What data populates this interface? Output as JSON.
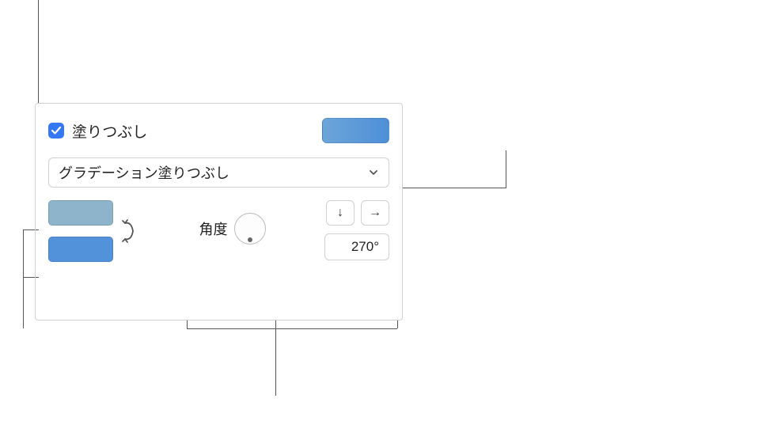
{
  "fill": {
    "checkbox_checked": true,
    "label": "塗りつぶし",
    "type_dropdown": "グラデーション塗りつぶし",
    "preview_gradient": {
      "start": "#6ca5d9",
      "end": "#4e8fd8"
    },
    "stops": [
      {
        "color": "#8eb4cc"
      },
      {
        "color": "#5292db"
      }
    ],
    "angle": {
      "label": "角度",
      "value": "270°"
    },
    "direction_icons": {
      "down": "↓",
      "right": "→"
    },
    "swap_icon": "swap-vertical"
  }
}
